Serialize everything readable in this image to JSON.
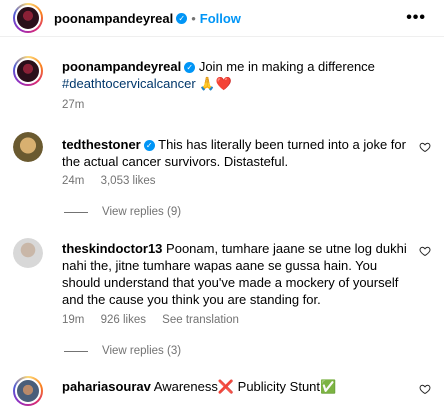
{
  "header": {
    "username": "poonampandeyreal",
    "separator": "•",
    "follow_label": "Follow",
    "more_label": "•••"
  },
  "caption": {
    "username": "poonampandeyreal",
    "text": "Join me in making a difference",
    "hashtag": "#deathtocervicalcancer",
    "emoji": "🙏❤️",
    "time": "27m"
  },
  "comments": [
    {
      "username": "tedthestoner",
      "verified": true,
      "text": "This has literally been turned into a joke for the actual cancer survivors. Distasteful.",
      "time": "24m",
      "likes": "3,053 likes",
      "replies": "View replies (9)"
    },
    {
      "username": "theskindoctor13",
      "verified": false,
      "text": "Poonam, tumhare jaane se utne log dukhi nahi the, jitne tumhare wapas aane se gussa hain. You should understand that you've made a mockery of yourself and the cause you think you are standing for.",
      "time": "19m",
      "likes": "926 likes",
      "translation": "See translation",
      "replies": "View replies (3)"
    },
    {
      "username": "paharia sourav",
      "username_display": "pahariasourav",
      "verified": false,
      "text": "Awareness❌ Publicity Stunt✅"
    }
  ],
  "icons": {
    "verified": "verified-badge-icon",
    "heart": "heart-outline-icon",
    "more": "more-options-icon"
  },
  "colors": {
    "accent": "#0095f6",
    "link": "#00376b",
    "muted": "#737373"
  }
}
